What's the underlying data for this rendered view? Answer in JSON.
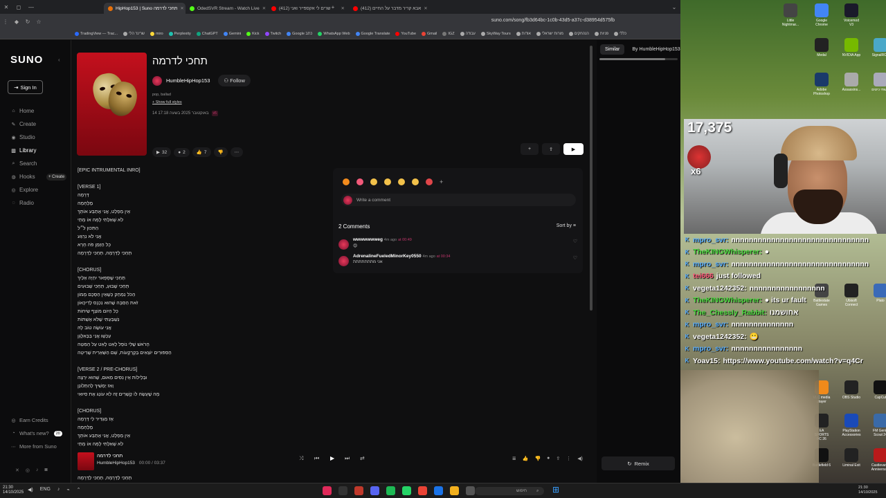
{
  "browser": {
    "tabs": [
      {
        "label": "HipHop153 | Suno תחכי לדרמה",
        "active": true,
        "color": "#e8710a"
      },
      {
        "label": "OdedSVR Stream - Watch Live",
        "active": false,
        "color": "#53fc18"
      },
      {
        "label": "(412) שרים לי אקספייר ואני",
        "active": false,
        "color": "#ff0000"
      },
      {
        "label": "(412) אבא קריר מדבר על החיים",
        "active": false,
        "color": "#ff0000"
      }
    ],
    "url": "suno.com/song/fb3d64bc-1c0b-43d5-a37c-d38954d575fb",
    "bookmarks": [
      "TradingView — Trac...",
      "שרינר הלי",
      "miro",
      "Perplexity",
      "ChatGPT",
      "Gemini",
      "Kick",
      "Twitch",
      "Google כתב",
      "WhatsApp Web",
      "Google Translate",
      "YouTube",
      "Gmail",
      "IGZ",
      "עבודה",
      "SkyWay Tours",
      "אודות",
      "מורות ישראלי",
      "הנהחקים",
      "פניות",
      "כללי"
    ]
  },
  "sidebar": {
    "logo": "SUNO",
    "collapse_glyph": "‹",
    "signin": "Sign In",
    "items": [
      {
        "label": "Home",
        "icon": "⌂",
        "active": false
      },
      {
        "label": "Create",
        "icon": "✎",
        "active": false
      },
      {
        "label": "Studio",
        "icon": "◉",
        "active": false
      },
      {
        "label": "Library",
        "icon": "▥",
        "active": true
      },
      {
        "label": "Search",
        "icon": "⌕",
        "active": false
      },
      {
        "label": "Hooks",
        "icon": "◍",
        "active": false,
        "pill": "+ Create"
      },
      {
        "label": "Explore",
        "icon": "◎",
        "active": false
      },
      {
        "label": "Radio",
        "icon": "◌",
        "active": false
      }
    ],
    "bottom": {
      "earn": "Earn Credits",
      "whatsnew": "What's new?",
      "whatsnew_badge": "20",
      "more": "More from Suno"
    },
    "socials": [
      "✕",
      "◎",
      "♪",
      "◙"
    ]
  },
  "song": {
    "title": "תחכי לדרמה",
    "artist": "HumbleHipHop153",
    "follow": "Follow",
    "genre": "pop, ballad",
    "show_styles": "+ Show full styles",
    "date": "14 באוקטובר 2025 בשעה 17:18",
    "version": "v5",
    "plays": "32",
    "comments": "2",
    "likes": "7"
  },
  "lyrics": [
    "[EPIC INTRUMENTAL INRO]",
    "",
    "[VERSE 1]",
    "דְּרָמָה",
    "מֶלְחָמָה",
    "אֵין מַפְלֵט, אֲנִי אֶתְבַּע אוֹתָךְ",
    "לֹא שָׁאַלְתִּי לָמָּה אוֹ מָתַי",
    "הַתִּכּוּן לֹ״ל",
    "אֲנִי לֹא נִרְגַּע",
    "כָּל הַזְּמַן פֹּה חָרָא",
    "תְּחַכִּי לַדְּרָמָה, תְּחַכִּי לַדְּרָמָה",
    "",
    "[CHORUS]",
    "תְּחַכִּי שֶׁסָּפָאר יִחְיֶה אֵלַיִךְ",
    "תְּחַכִּי שֶׁבּוּעַ, תְּחַכִּי שָׁבוּעִים",
    "הַכֹּל נִמְחַק כְּשֶׁאֵין הַסֵּכֶם מָמוֹן",
    "זֹאת הַסִּבָּה שֶׁהוּא נִכְנָס לְדִיכָּאוֹן",
    "כָּל הַיּוֹם מוֹצֵף שִׂיחוֹת",
    "נִשְׁבַּעְתִּי שֶׁלֹּא אֶשְׁתּוֹת",
    "אֲנִי עוֹשֶׂה טוֹב לָהּ",
    "עַכְשָׁו אֲנִי בַּבְּאַלָגָן",
    "הָרֹאשׁ שֶׁלִּי נוֹפֵל לְאַט לְאַט עַל הַמִּטָּה",
    "הַסִּפּוּרִים יוֹצְאִים בְּקָרְקָעוֹת, שָׁם הַשְּׁאֵרִית שֶׁרִיטָה",
    "",
    "[VERSE 2 / PRE-CHORUS]",
    "וּבְלֵילוֹת אֵין נִסִּים מְאוּם, שֶׁהוּא יִרְצֶה",
    "וְאִז יַמְשִׁיךְ לְהִתְלוֹנֵן",
    "מָה שֶׁעָשָׂה לוֹ קְשָׁרִים זֶה לֹא עוֹנֵג אֶת סִיוּאִי",
    "",
    "[CHORUS]",
    "אָז מַגְדִּיר לִי דְּרָמָה",
    "מֶלְחָמָה",
    "אֵין מַפְלֵט, אֲנִי אֶתְבַּע אוֹתָךְ",
    "לֹא שָׁאַלְתִּי לָמָּה אוֹ מָתַי"
  ],
  "reactions": {
    "emojis": [
      {
        "name": "fire-emoji",
        "color": "#f28b1d"
      },
      {
        "name": "heart-eyes-emoji",
        "color": "#f25a7a"
      },
      {
        "name": "scream-emoji",
        "color": "#f2c14a"
      },
      {
        "name": "raised-hands-emoji",
        "color": "#f2c14a"
      },
      {
        "name": "thumbs-up-emoji",
        "color": "#f2c14a"
      },
      {
        "name": "thumbs-down-emoji",
        "color": "#f2c14a"
      },
      {
        "name": "devil-emoji",
        "color": "#e0464a"
      }
    ],
    "comment_placeholder": "Write a comment",
    "count_label": "2 Comments",
    "sort_label": "Sort by"
  },
  "comments": [
    {
      "user": "wwwwwwweg",
      "time": "4m ago",
      "at": "at 00:49",
      "body": "😍"
    },
    {
      "user": "AdrenalineFueledMinorKey0550",
      "time": "4m ago",
      "at": "at 00:34",
      "body": "אני מתתתתתתת"
    }
  ],
  "right_panel": {
    "tab_similar": "Similar",
    "tab_by": "By HumbleHipHop153",
    "remix": "Remix"
  },
  "player": {
    "title": "תחכי לדרמה",
    "artist": "HumbleHipHop153",
    "time": "00:00 / 03:37",
    "bottom_line": "תְּחַכִּי לַדְּרָמָה, תְּחַכִּי לַדְּרָמָה"
  },
  "taskbar": {
    "time": "21:30",
    "date": "14/10/2025",
    "search_placeholder": "חיפוש",
    "lang": "ENG",
    "right_time": "21:30",
    "right_date": "14/10/2025"
  },
  "stream": {
    "viewers": "17,375",
    "multiplier": "x6",
    "chat": [
      {
        "user": "mpro_svr:",
        "msg": "nnnnnnnnnnnnnnnnnnnnnnnnnnnnnnn",
        "color": "#5ab0ff"
      },
      {
        "user": "TheKINGWhisperer:",
        "msg": "●",
        "color": "#4cdc40"
      },
      {
        "user": "mpro_svr:",
        "msg": "nnnnnnnnnnnnnnnnnnnnnnnnnnnnnnn",
        "color": "#5ab0ff"
      },
      {
        "user": "tei666",
        "msg": "just followed",
        "color": "#ff5a7a"
      },
      {
        "user": "vegeta1242352:",
        "msg": "nnnnnnnnnnnnnnnnn",
        "color": "#ffffff"
      },
      {
        "user": "TheKINGWhisperer:",
        "msg": "● its ur fault",
        "color": "#4cdc40"
      },
      {
        "user": "The_Chessly_Rabbit:",
        "msg": "אחושמנו",
        "color": "#4cdc40"
      },
      {
        "user": "mpro_svr:",
        "msg": "nnnnnnnnnnnnnn",
        "color": "#5ab0ff"
      },
      {
        "user": "vegeta1242352:",
        "msg": "😬",
        "color": "#ffffff"
      },
      {
        "user": "mpro_svr:",
        "msg": "nnnnnnnnnnnnnnnn",
        "color": "#5ab0ff"
      },
      {
        "user": "Yoav15:",
        "msg": "https://www.youtube.com/watch?v=q4Cr",
        "color": "#ffffff"
      }
    ],
    "desktop_icons": [
      {
        "label": "Little Nightmar...",
        "color": "#444"
      },
      {
        "label": "Google Chrome",
        "color": "#4285f4"
      },
      {
        "label": "Voicemod V3",
        "color": "#1a1a2a"
      },
      {
        "label": "Medal",
        "color": "#222"
      },
      {
        "label": "NVIDIA App",
        "color": "#76b900"
      },
      {
        "label": "SignalRGB",
        "color": "#4aa8c8"
      },
      {
        "label": "Adobe Photoshop",
        "color": "#1a3a6a"
      },
      {
        "label": "Assassins...",
        "color": "#aaa"
      },
      {
        "label": "ל שתי כיטים",
        "color": "#aab"
      },
      {
        "label": "Battlestate Games",
        "color": "#444"
      },
      {
        "label": "Ubisoft Connect",
        "color": "#222"
      },
      {
        "label": "Plato",
        "color": "#3a6ab8"
      },
      {
        "label": "VLC media player",
        "color": "#f08a1a"
      },
      {
        "label": "OBS Studio",
        "color": "#222"
      },
      {
        "label": "CapCut",
        "color": "#111"
      },
      {
        "label": "EA SPORTS FC 26",
        "color": "#222"
      },
      {
        "label": "PlayStation Accessories",
        "color": "#1a4ab8"
      },
      {
        "label": "FM Genie Scout 24",
        "color": "#3a6aa8"
      },
      {
        "label": "Battlefield 6",
        "color": "#111"
      },
      {
        "label": "Liminal Exit",
        "color": "#222"
      },
      {
        "label": "Castlevania Anniversary",
        "color": "#b81a1a"
      }
    ]
  }
}
